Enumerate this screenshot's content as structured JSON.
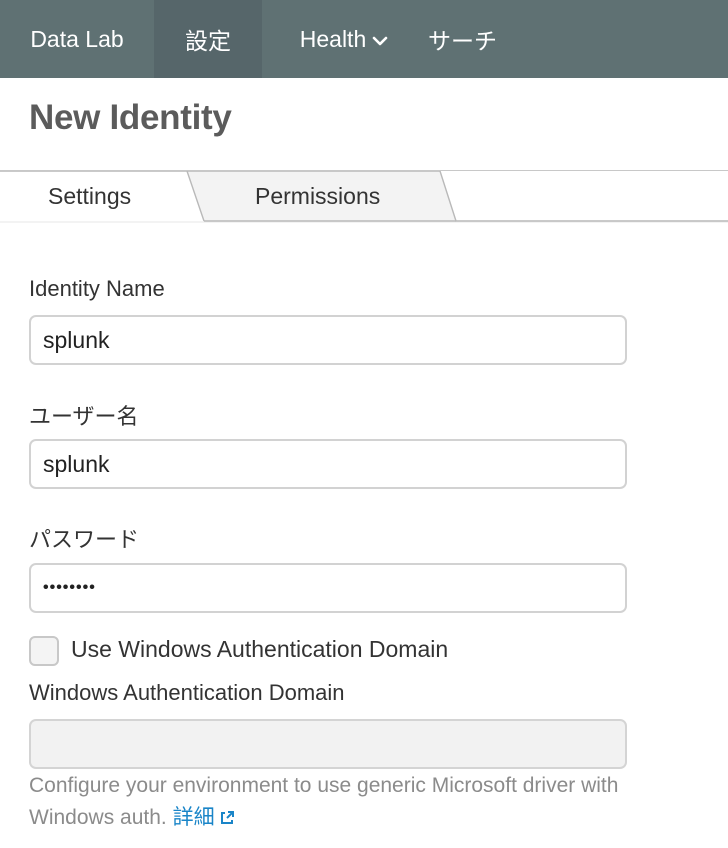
{
  "nav": {
    "app_name": "Data Lab",
    "settings": "設定",
    "health": "Health",
    "search": "サーチ"
  },
  "page": {
    "title": "New Identity"
  },
  "tabs": [
    {
      "label": "Settings",
      "active": true
    },
    {
      "label": "Permissions",
      "active": false
    }
  ],
  "form": {
    "identity_name": {
      "label": "Identity Name",
      "value": "splunk"
    },
    "username": {
      "label": "ユーザー名",
      "value": "splunk"
    },
    "password": {
      "label": "パスワード",
      "value": "••••••••"
    },
    "use_windows_domain": {
      "label": "Use Windows Authentication Domain",
      "checked": false
    },
    "windows_domain": {
      "label": "Windows Authentication Domain",
      "value": ""
    },
    "help_text": "Configure your environment to use generic Microsoft driver with Windows auth.",
    "help_link": "詳細"
  },
  "colors": {
    "nav_bg": "#5f7173",
    "nav_active_bg": "#56666a",
    "link": "#1a85c8"
  }
}
